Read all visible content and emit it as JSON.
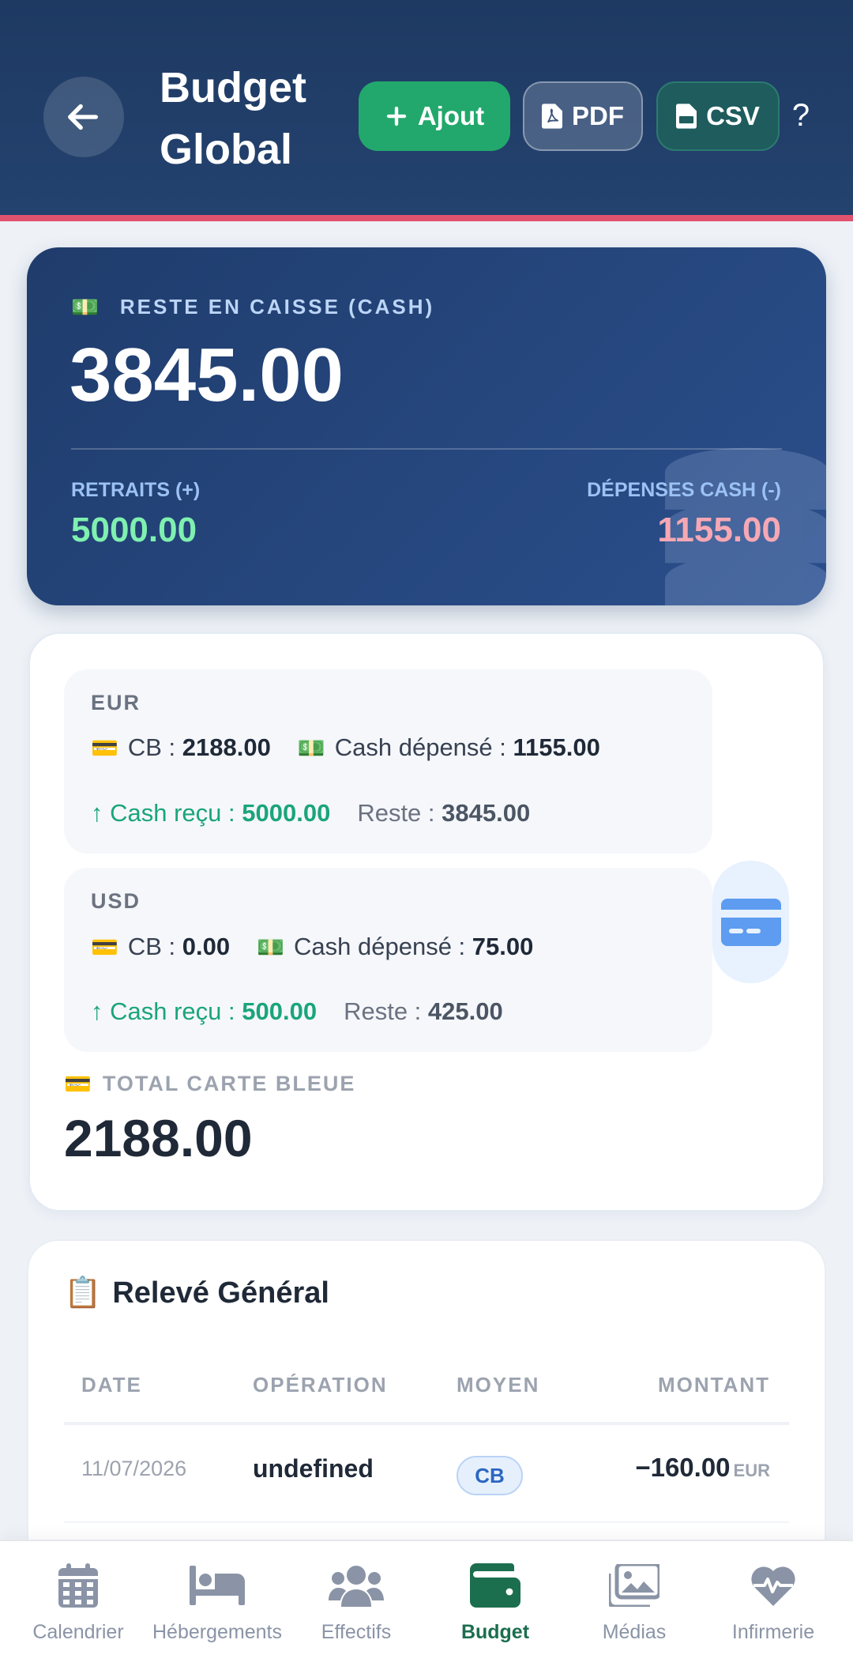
{
  "header": {
    "back_icon": "arrow-left-icon",
    "title": "Budget Global",
    "buttons": {
      "add_label": "Ajout",
      "pdf_label": "PDF",
      "csv_label": "CSV",
      "help_label": "?"
    }
  },
  "cash": {
    "label": "RESTE EN CAISSE (CASH)",
    "amount": "3845.00",
    "retraits_label": "RETRAITS (+)",
    "retraits_value": "5000.00",
    "depenses_label": "DÉPENSES CASH (-)",
    "depenses_value": "1155.00"
  },
  "currencies": [
    {
      "code": "EUR",
      "cb_label": "CB :",
      "cb_value": "2188.00",
      "spent_label": "Cash dépensé :",
      "spent_value": "1155.00",
      "received_label": "↑ Cash reçu :",
      "received_value": "5000.00",
      "reste_label": "Reste :",
      "reste_value": "3845.00"
    },
    {
      "code": "USD",
      "cb_label": "CB :",
      "cb_value": "0.00",
      "spent_label": "Cash dépensé :",
      "spent_value": "75.00",
      "received_label": "↑ Cash reçu :",
      "received_value": "500.00",
      "reste_label": "Reste :",
      "reste_value": "425.00"
    }
  ],
  "total_cb": {
    "label": "TOTAL CARTE BLEUE",
    "value": "2188.00"
  },
  "statement": {
    "title": "Relevé Général",
    "columns": [
      "DATE",
      "OPÉRATION",
      "MOYEN",
      "MONTANT"
    ],
    "rows": [
      {
        "date": "11/07/2026",
        "operation": "undefined",
        "method": "CB",
        "amount": "−160.00",
        "currency": "EUR"
      }
    ]
  },
  "nav": {
    "items": [
      {
        "label": "Calendrier",
        "icon": "calendar-icon"
      },
      {
        "label": "Hébergements",
        "icon": "bed-icon"
      },
      {
        "label": "Effectifs",
        "icon": "users-icon"
      },
      {
        "label": "Budget",
        "icon": "wallet-icon",
        "active": true
      },
      {
        "label": "Médias",
        "icon": "images-icon"
      },
      {
        "label": "Infirmerie",
        "icon": "heart-pulse-icon"
      }
    ]
  },
  "colors": {
    "header_bg": "#1e3a63",
    "header_border": "#e0526e",
    "add_button": "#22a86c",
    "positive": "#7ff0b0",
    "negative": "#f7a8b4",
    "received": "#1aa579",
    "nav_active": "#1b6e4e"
  }
}
